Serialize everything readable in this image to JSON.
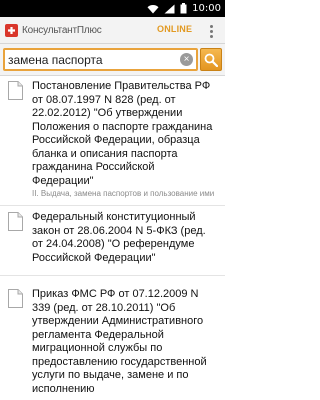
{
  "status_bar": {
    "time": "10:00"
  },
  "app_bar": {
    "logo_text": "КонсультантПлюс",
    "mode": "ONLINE"
  },
  "search": {
    "query": "замена паспорта",
    "placeholder": ""
  },
  "results": [
    {
      "title": "Постановление Правительства РФ от 08.07.1997 N 828 (ред. от 22.02.2012) \"Об утверждении Положения о паспорте гражданина Российской Федерации, образца бланка и описания паспорта гражданина Российской Федерации\"",
      "snippet": "II. Выдача, замена паспортов и пользование ими"
    },
    {
      "title": "Федеральный конституционный закон от 28.06.2004 N 5-ФКЗ (ред. от 24.04.2008) \"О референдуме Российской Федерации\"",
      "snippet": ""
    },
    {
      "title": "Приказ ФМС РФ от 07.12.2009 N 339 (ред. от 28.10.2011) \"Об утверждении Административного регламента Федеральной миграционной службы по предоставлению государственной услуги по выдаче, замене и по исполнению",
      "snippet": ""
    }
  ],
  "colors": {
    "accent": "#e9a33c",
    "online": "#e29a23"
  }
}
